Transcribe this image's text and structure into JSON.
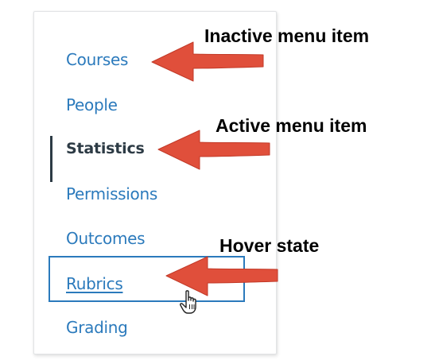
{
  "menu": {
    "items": [
      {
        "label": "Courses",
        "state": "inactive"
      },
      {
        "label": "People",
        "state": "inactive"
      },
      {
        "label": "Statistics",
        "state": "active"
      },
      {
        "label": "Permissions",
        "state": "inactive"
      },
      {
        "label": "Outcomes",
        "state": "inactive"
      },
      {
        "label": "Rubrics",
        "state": "hover"
      },
      {
        "label": "Grading",
        "state": "inactive"
      }
    ]
  },
  "annotations": {
    "inactive": "Inactive menu item",
    "active": "Active menu item",
    "hover": "Hover state"
  },
  "icons": {
    "cursor": "hand-pointer-icon",
    "arrow": "left-arrow-icon"
  },
  "colors": {
    "link": "#2b7abc",
    "active_text": "#2d3b45",
    "arrow": "#e04f3b",
    "annotation_text": "#000000"
  }
}
